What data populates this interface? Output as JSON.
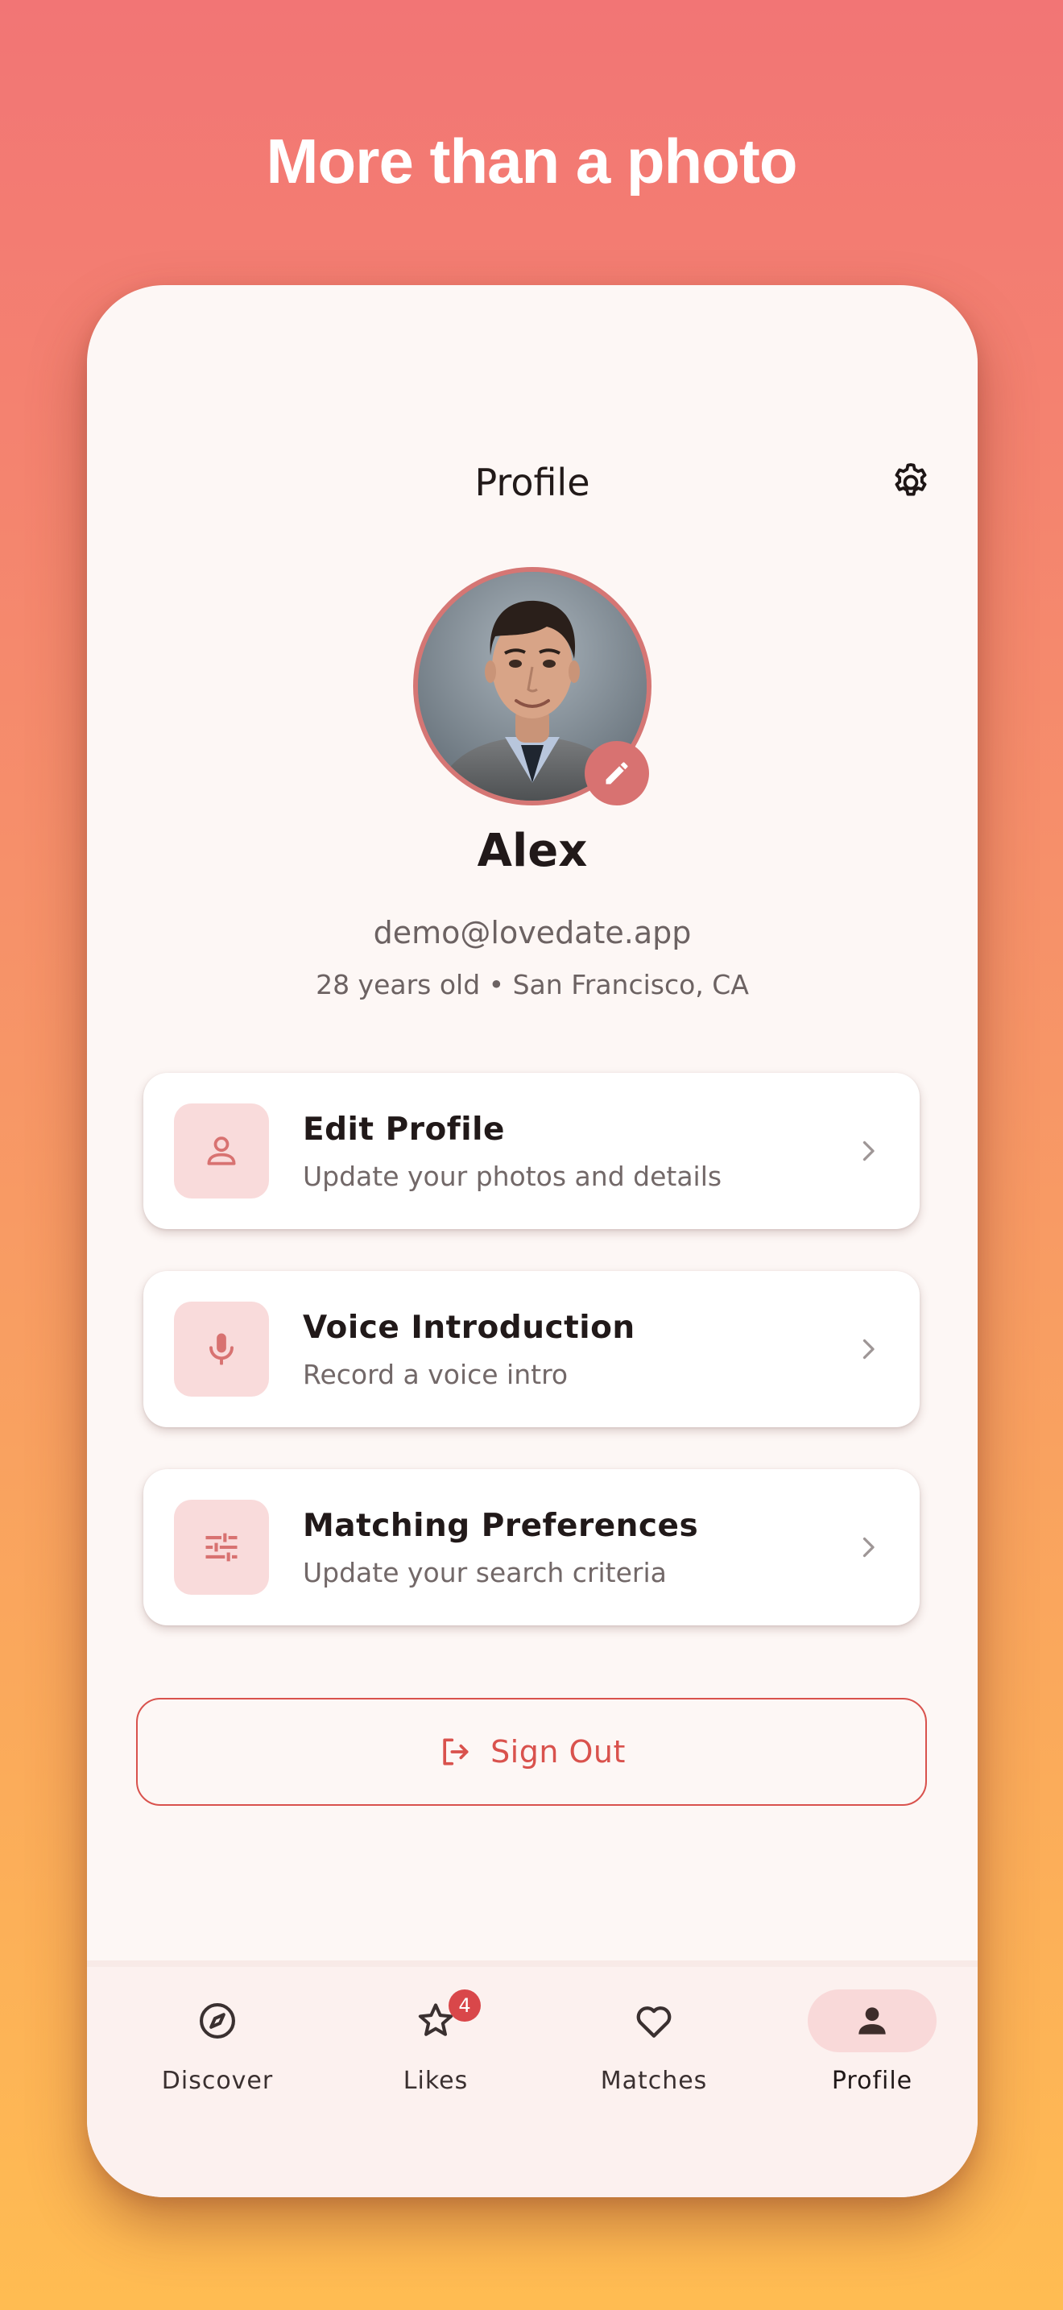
{
  "promo": {
    "headline": "More than a photo"
  },
  "header": {
    "title": "Profile",
    "settings_icon": "gear-icon"
  },
  "profile": {
    "name": "Alex",
    "email": "demo@lovedate.app",
    "meta": "28 years old • San Francisco, CA",
    "edit_icon": "pencil-icon"
  },
  "menu": {
    "items": [
      {
        "title": "Edit Profile",
        "subtitle": "Update your photos and details",
        "icon": "person-icon"
      },
      {
        "title": "Voice Introduction",
        "subtitle": "Record a voice intro",
        "icon": "microphone-icon"
      },
      {
        "title": "Matching Preferences",
        "subtitle": "Update your search criteria",
        "icon": "sliders-icon"
      }
    ]
  },
  "sign_out": {
    "label": "Sign Out",
    "icon": "logout-icon"
  },
  "nav": {
    "items": [
      {
        "label": "Discover",
        "icon": "compass-icon",
        "active": false
      },
      {
        "label": "Likes",
        "icon": "star-icon",
        "active": false,
        "badge": "4"
      },
      {
        "label": "Matches",
        "icon": "heart-icon",
        "active": false
      },
      {
        "label": "Profile",
        "icon": "person-icon",
        "active": true
      }
    ]
  },
  "colors": {
    "accent": "#D9524D",
    "avatar_ring": "#D57674",
    "icon_tile": "#F9DBDB",
    "active_pill": "#F9D9D9",
    "badge": "#D9474A",
    "gradient_top": "#F27575",
    "gradient_bottom": "#FFBC52"
  }
}
